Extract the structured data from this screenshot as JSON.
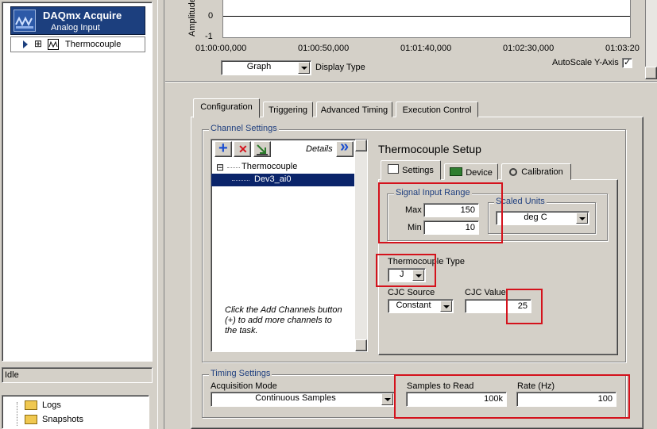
{
  "window": {
    "tree_root_title": "DAQmx Acquire",
    "tree_root_subtitle": "Analog Input",
    "tree_child": "Thermocouple",
    "expand_glyph": "⊞",
    "status": "Idle",
    "bottom_items": [
      "Logs",
      "Snapshots"
    ]
  },
  "graph": {
    "y_axis_label": "Amplitude",
    "y_ticks": [
      "0",
      "-1"
    ],
    "x_ticks": [
      "01:00:00,000",
      "01:00:50,000",
      "01:01:40,000",
      "01:02:30,000",
      "01:03:20"
    ],
    "display_type_value": "Graph",
    "display_type_label": "Display Type",
    "autoscale_label": "AutoScale Y-Axis",
    "autoscale_checked": "✓"
  },
  "tabs": [
    "Configuration",
    "Triggering",
    "Advanced Timing",
    "Execution Control"
  ],
  "channel_settings": {
    "title": "Channel Settings",
    "details_label": "Details",
    "details_glyph": "»",
    "add_glyph": "+",
    "remove_glyph": "✕",
    "tree_collapse_glyph": "⊟",
    "tree_parent": "Thermocouple",
    "tree_channel": "Dev3_ai0",
    "hint": "Click the Add Channels button (+) to add more channels to the task."
  },
  "setup": {
    "title": "Thermocouple Setup",
    "subtabs": [
      "Settings",
      "Device",
      "Calibration"
    ],
    "signal_input_range": {
      "title": "Signal Input Range",
      "max_label": "Max",
      "max_value": "150",
      "min_label": "Min",
      "min_value": "10"
    },
    "scaled_units": {
      "title": "Scaled Units",
      "value": "deg C"
    },
    "thermocouple_type": {
      "label": "Thermocouple Type",
      "value": "J"
    },
    "cjc_source": {
      "label": "CJC Source",
      "value": "Constant"
    },
    "cjc_value": {
      "label": "CJC Value",
      "value": "25"
    }
  },
  "timing": {
    "title": "Timing Settings",
    "acq_mode_label": "Acquisition Mode",
    "acq_mode_value": "Continuous Samples",
    "samples_label": "Samples to Read",
    "samples_value": "100k",
    "rate_label": "Rate (Hz)",
    "rate_value": "100"
  },
  "colors": {
    "highlight_box": "#d4121c",
    "selection": "#0a246a",
    "header": "#1c3f7e"
  }
}
